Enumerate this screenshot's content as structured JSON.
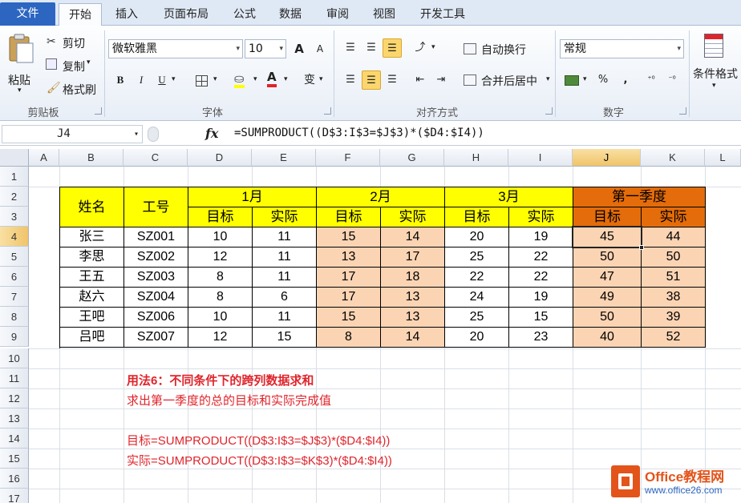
{
  "tabs": [
    "文件",
    "开始",
    "插入",
    "页面布局",
    "公式",
    "数据",
    "审阅",
    "视图",
    "开发工具"
  ],
  "clipboard": {
    "paste": "粘贴",
    "cut": "剪切",
    "copy": "复制",
    "format_painter": "格式刷",
    "group": "剪贴板"
  },
  "font": {
    "name": "微软雅黑",
    "size": "10",
    "group": "字体",
    "bold": "B",
    "italic": "I",
    "underline": "U",
    "grow": "A",
    "shrink": "A",
    "phonetic": "变"
  },
  "alignment": {
    "wrap": "自动换行",
    "merge": "合并后居中",
    "group": "对齐方式"
  },
  "number": {
    "format": "常规",
    "percent": "%",
    "comma": ",",
    "group": "数字"
  },
  "styles": {
    "conditional": "条件格式"
  },
  "namebox": "J4",
  "formula": "=SUMPRODUCT((D$3:I$3=$J$3)*($D4:$I4))",
  "columns": [
    "A",
    "B",
    "C",
    "D",
    "E",
    "F",
    "G",
    "H",
    "I",
    "J",
    "K",
    "L"
  ],
  "rows": [
    "1",
    "2",
    "3",
    "4",
    "5",
    "6",
    "7",
    "8",
    "9",
    "10",
    "11",
    "12",
    "13",
    "14",
    "15",
    "16",
    "17"
  ],
  "table": {
    "h_name": "姓名",
    "h_id": "工号",
    "months": [
      "1月",
      "2月",
      "3月",
      "第一季度"
    ],
    "target": "目标",
    "actual": "实际",
    "data": [
      [
        "张三",
        "SZ001",
        "10",
        "11",
        "15",
        "14",
        "20",
        "19",
        "45",
        "44"
      ],
      [
        "李思",
        "SZ002",
        "12",
        "11",
        "13",
        "17",
        "25",
        "22",
        "50",
        "50"
      ],
      [
        "王五",
        "SZ003",
        "8",
        "11",
        "17",
        "18",
        "22",
        "22",
        "47",
        "51"
      ],
      [
        "赵六",
        "SZ004",
        "8",
        "6",
        "17",
        "13",
        "24",
        "19",
        "49",
        "38"
      ],
      [
        "王吧",
        "SZ006",
        "10",
        "11",
        "15",
        "13",
        "25",
        "15",
        "50",
        "39"
      ],
      [
        "吕吧",
        "SZ007",
        "12",
        "15",
        "8",
        "14",
        "20",
        "23",
        "40",
        "52"
      ]
    ]
  },
  "notes": {
    "title": "用法6：不同条件下的跨列数据求和",
    "desc": "求出第一季度的总的目标和实际完成值",
    "target_formula": "目标=SUMPRODUCT((D$3:I$3=$J$3)*($D4:$I4))",
    "actual_formula": "实际=SUMPRODUCT((D$3:I$3=$K$3)*($D4:$I4))"
  },
  "watermark": {
    "brand": "Office教程网",
    "url": "www.office26.com"
  },
  "colors": {
    "yellow": "#ffff00",
    "orange": "#e46c0a",
    "peach": "#fbd4b4",
    "note_red": "#e0242b",
    "file_tab": "#2c66c1"
  }
}
